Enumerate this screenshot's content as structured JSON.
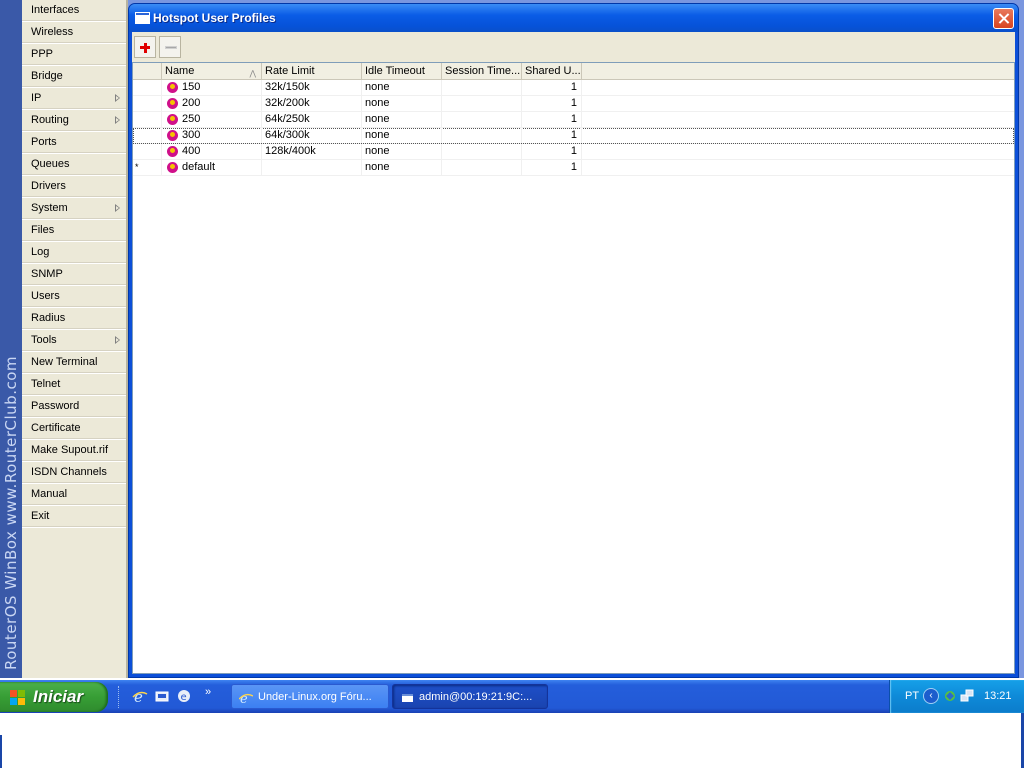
{
  "sidebar": {
    "banner_text": "RouterOS WinBox   www.RouterClub.com",
    "items": [
      {
        "label": "Interfaces",
        "has_submenu": false
      },
      {
        "label": "Wireless",
        "has_submenu": false
      },
      {
        "label": "PPP",
        "has_submenu": false
      },
      {
        "label": "Bridge",
        "has_submenu": false
      },
      {
        "label": "IP",
        "has_submenu": true
      },
      {
        "label": "Routing",
        "has_submenu": true
      },
      {
        "label": "Ports",
        "has_submenu": false
      },
      {
        "label": "Queues",
        "has_submenu": false
      },
      {
        "label": "Drivers",
        "has_submenu": false
      },
      {
        "label": "System",
        "has_submenu": true
      },
      {
        "label": "Files",
        "has_submenu": false
      },
      {
        "label": "Log",
        "has_submenu": false
      },
      {
        "label": "SNMP",
        "has_submenu": false
      },
      {
        "label": "Users",
        "has_submenu": false
      },
      {
        "label": "Radius",
        "has_submenu": false
      },
      {
        "label": "Tools",
        "has_submenu": true
      },
      {
        "label": "New Terminal",
        "has_submenu": false
      },
      {
        "label": "Telnet",
        "has_submenu": false
      },
      {
        "label": "Password",
        "has_submenu": false
      },
      {
        "label": "Certificate",
        "has_submenu": false
      },
      {
        "label": "Make Supout.rif",
        "has_submenu": false
      },
      {
        "label": "ISDN Channels",
        "has_submenu": false
      },
      {
        "label": "Manual",
        "has_submenu": false
      },
      {
        "label": "Exit",
        "has_submenu": false
      }
    ]
  },
  "window": {
    "title": "Hotspot User Profiles",
    "toolbar": {
      "add_icon": "plus-icon",
      "remove_icon": "minus-icon"
    },
    "columns": [
      "Name",
      "Rate Limit",
      "Idle Timeout",
      "Session Time...",
      "Shared U..."
    ],
    "sorted_column": "Name",
    "rows": [
      {
        "flag": "",
        "name": "150",
        "rate_limit": "32k/150k",
        "idle_timeout": "none",
        "session_timeout": "",
        "shared_users": "1",
        "selected": false
      },
      {
        "flag": "",
        "name": "200",
        "rate_limit": "32k/200k",
        "idle_timeout": "none",
        "session_timeout": "",
        "shared_users": "1",
        "selected": false
      },
      {
        "flag": "",
        "name": "250",
        "rate_limit": "64k/250k",
        "idle_timeout": "none",
        "session_timeout": "",
        "shared_users": "1",
        "selected": false
      },
      {
        "flag": "",
        "name": "300",
        "rate_limit": "64k/300k",
        "idle_timeout": "none",
        "session_timeout": "",
        "shared_users": "1",
        "selected": true
      },
      {
        "flag": "",
        "name": "400",
        "rate_limit": "128k/400k",
        "idle_timeout": "none",
        "session_timeout": "",
        "shared_users": "1",
        "selected": false
      },
      {
        "flag": "*",
        "name": "default",
        "rate_limit": "",
        "idle_timeout": "none",
        "session_timeout": "",
        "shared_users": "1",
        "selected": false
      }
    ]
  },
  "taskbar": {
    "start_label": "Iniciar",
    "quicklaunch_overflow": "»",
    "tasks": [
      {
        "label": "Under-Linux.org Fóru...",
        "active": false
      },
      {
        "label": "admin@00:19:21:9C:...",
        "active": true
      }
    ],
    "tray": {
      "language": "PT",
      "chevron": "‹",
      "clock": "13:21"
    }
  },
  "colors": {
    "titlebar": "#0a5ce6",
    "desktop": "#7a96df",
    "taskbar": "#245edb",
    "start": "#379e35",
    "tray": "#0e8ad8",
    "profile_icon": "#d0108a"
  }
}
